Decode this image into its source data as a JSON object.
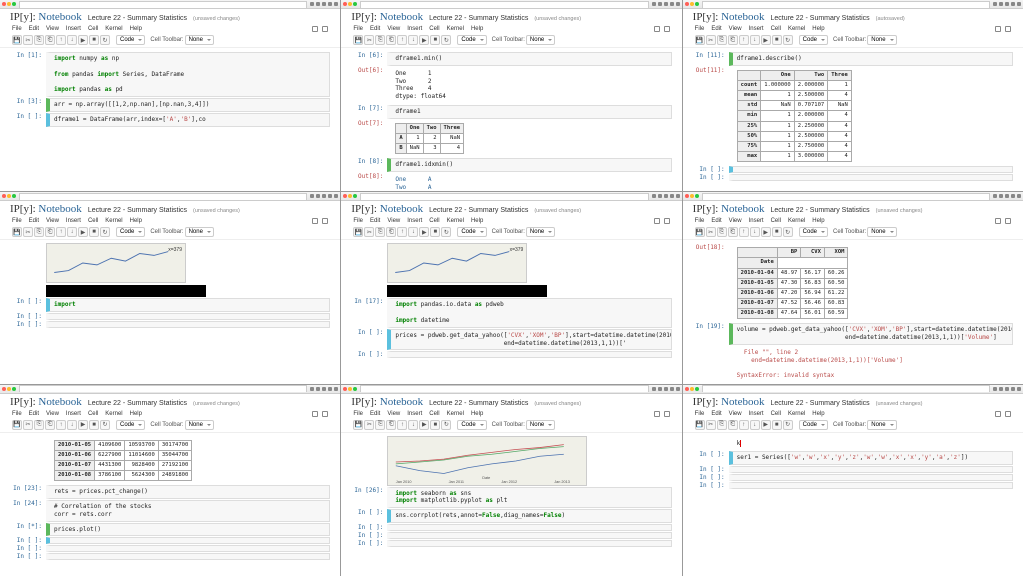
{
  "logo_prefix": "IP[y]:",
  "logo_word": "Notebook",
  "title": "Lecture 22 - Summary Statistics",
  "status_unsaved": "(unsaved changes)",
  "status_autosaved": "(autosaved)",
  "menus": [
    "File",
    "Edit",
    "View",
    "Insert",
    "Cell",
    "Kernel",
    "Help"
  ],
  "toolbar_icons": [
    "💾",
    "✂",
    "⎘",
    "⎗",
    "↑",
    "↓",
    "▶",
    "■",
    "↻"
  ],
  "celltype": "Code",
  "celltoolbar_label": "Cell Toolbar:",
  "celltoolbar_value": "None",
  "panes": {
    "p1": {
      "cells": [
        {
          "p": "In [1]:",
          "c": "import numpy as np\n\nfrom pandas import Series, DataFrame\n\nimport pandas as pd"
        },
        {
          "p": "In [3]:",
          "c": "arr = np.array([[1,2,np.nan],[np.nan,3,4]])",
          "sel": "g"
        },
        {
          "p": "In [ ]:",
          "c": "dframe1 = DataFrame(arr,index=['A','B'],co",
          "sel": "b"
        }
      ]
    },
    "p2": {
      "cells": [
        {
          "p": "In [6]:",
          "c": "dframe1.min()"
        },
        {
          "p": "Out[6]:",
          "out": true,
          "c": "One      1\nTwo      2\nThree    4\ndtype: float64"
        },
        {
          "p": "In [7]:",
          "c": "dframe1"
        },
        {
          "p": "Out[7]:",
          "out": true,
          "table": {
            "idx": [
              "A",
              "B"
            ],
            "cols": [
              "One",
              "Two",
              "Three"
            ],
            "rows": [
              [
                "1",
                "2",
                "NaN"
              ],
              [
                "NaN",
                "3",
                "4"
              ]
            ]
          }
        },
        {
          "p": "In [8]:",
          "c": "dframe1.idxmin()",
          "sel": "g"
        },
        {
          "p": "Out[8]:",
          "out": true,
          "c": "One      A\nTwo      A\nThree    B\ndtype: object",
          "blue": true
        },
        {
          "p": "In [ ]:",
          "c": "",
          "sel": "b"
        }
      ]
    },
    "p3": {
      "status": "autosaved",
      "cells": [
        {
          "p": "In [11]:",
          "c": "dframe1.describe()",
          "sel": "g"
        },
        {
          "p": "Out[11]:",
          "out": true,
          "table": {
            "idx": [
              "count",
              "mean",
              "std",
              "min",
              "25%",
              "50%",
              "75%",
              "max"
            ],
            "cols": [
              "One",
              "Two",
              "Three"
            ],
            "rows": [
              [
                "1.000000",
                "2.000000",
                "1"
              ],
              [
                "1",
                "2.500000",
                "4"
              ],
              [
                "NaN",
                "0.707107",
                "NaN"
              ],
              [
                "1",
                "2.000000",
                "4"
              ],
              [
                "1",
                "2.250000",
                "4"
              ],
              [
                "1",
                "2.500000",
                "4"
              ],
              [
                "1",
                "2.750000",
                "4"
              ],
              [
                "1",
                "3.000000",
                "4"
              ]
            ]
          }
        },
        {
          "p": "In [ ]:",
          "c": "",
          "sel": "b"
        },
        {
          "p": "In [ ]:",
          "c": ""
        }
      ]
    },
    "p4": {
      "chart": "partial",
      "cells": [
        {
          "p": "In [ ]:",
          "c": "import",
          "sel": "b"
        },
        {
          "p": "In [ ]:",
          "c": ""
        },
        {
          "p": "In [ ]:",
          "c": ""
        }
      ]
    },
    "p5": {
      "chart": "partial",
      "cells": [
        {
          "p": "In [17]:",
          "c": "import pandas.io.data as pdweb\n\nimport datetime"
        },
        {
          "p": "In [ ]:",
          "c": "prices = pdweb.get_data_yahoo(['CVX','XOM','BP'],start=datetime.datetime(2010,1,1),\n                              end=datetime.datetime(2013,1,1))['",
          "sel": "b"
        },
        {
          "p": "In [ ]:",
          "c": ""
        }
      ]
    },
    "p6": {
      "cells": [
        {
          "p": "Out[18]:",
          "out": true,
          "pxtable": {
            "idxname": "Date",
            "cols": [
              "BP",
              "CVX",
              "XOM"
            ],
            "idx": [
              "2010-01-04",
              "2010-01-05",
              "2010-01-06",
              "2010-01-07",
              "2010-01-08"
            ],
            "rows": [
              [
                "48.97",
                "56.17",
                "60.26"
              ],
              [
                "47.30",
                "56.83",
                "60.50"
              ],
              [
                "47.20",
                "56.94",
                "61.22"
              ],
              [
                "47.52",
                "56.46",
                "60.83"
              ],
              [
                "47.64",
                "56.01",
                "60.59"
              ]
            ]
          }
        },
        {
          "p": "In [19]:",
          "c": "volume = pdweb.get_data_yahoo(['CVX','XOM','BP'],start=datetime.datetime(2010,1,1),\n                              end=datetime.datetime(2013,1,1))['Volume']",
          "sel": "g"
        },
        {
          "p": "",
          "out": true,
          "c": "  File \"<ipython-input-19-530d601ac437>\", line 2\n    end=datetime.datetime(2013,1,1))['Volume']\n\nSyntaxError: invalid syntax",
          "err": true
        },
        {
          "p": "In [ ]:",
          "c": "",
          "sel": "b",
          "mark": "y"
        },
        {
          "p": "In [ ]:",
          "c": ""
        }
      ]
    },
    "p7": {
      "cells": [
        {
          "p": "",
          "out": true,
          "voltable": {
            "idx": [
              "2010-01-05",
              "2010-01-06",
              "2010-01-07",
              "2010-01-08"
            ],
            "rows": [
              [
                "4109600",
                "10593700",
                "30174700"
              ],
              [
                "6227900",
                "11014600",
                "35044700"
              ],
              [
                "4431300",
                "9828400",
                "27192100"
              ],
              [
                "3786100",
                "5624300",
                "24891800"
              ]
            ]
          }
        },
        {
          "p": "In [23]:",
          "c": "rets = prices.pct_change()"
        },
        {
          "p": "In [24]:",
          "c": "# Correlation of the stocks\ncorr = rets.corr"
        },
        {
          "p": "In [*]:",
          "c": "prices.plot()",
          "sel": "g"
        },
        {
          "p": "In [ ]:",
          "c": "",
          "sel": "b"
        },
        {
          "p": "In [ ]:",
          "c": ""
        },
        {
          "p": "In [ ]:",
          "c": ""
        }
      ]
    },
    "p8": {
      "chart": "full",
      "cells": [
        {
          "p": "In [26]:",
          "c": "import seaborn as sns\nimport matplotlib.pyplot as plt"
        },
        {
          "p": "In [ ]:",
          "c": "sns.corrplot(rets,annot=False,diag_names=False)",
          "sel": "b"
        },
        {
          "p": "In [ ]:",
          "c": ""
        },
        {
          "p": "In [ ]:",
          "c": ""
        },
        {
          "p": "In [ ]:",
          "c": ""
        }
      ]
    },
    "p9": {
      "cells": [
        {
          "p": "",
          "out": true,
          "c": "k",
          "cursor": true,
          "marks": true
        },
        {
          "p": "In [ ]:",
          "c": "ser1 = Series(['w','w','x','y','z','w','w','x','x','y','a','z'])",
          "sel": "b"
        },
        {
          "p": "In [ ]:",
          "c": ""
        },
        {
          "p": "In [ ]:",
          "c": ""
        },
        {
          "p": "In [ ]:",
          "c": ""
        }
      ]
    }
  },
  "chart_data": [
    {
      "type": "line",
      "title": "",
      "series": [
        {
          "name": "x=379",
          "values": []
        }
      ],
      "note": "partial cropped line chart top of panes 4 and 5"
    },
    {
      "type": "line",
      "title": "",
      "xlabel": "Date",
      "categories": [
        "Jan 2010",
        "Jul 2010",
        "Jan 2011",
        "Jul 2011",
        "Jan 2012",
        "Jul 2012",
        "Jan 2013"
      ],
      "series": [
        {
          "name": "BP",
          "color": "#4c72b0"
        },
        {
          "name": "CVX",
          "color": "#55a868"
        },
        {
          "name": "XOM",
          "color": "#c44e52"
        }
      ],
      "ylim": [
        20,
        120
      ],
      "note": "stock price line chart pane 8"
    }
  ]
}
